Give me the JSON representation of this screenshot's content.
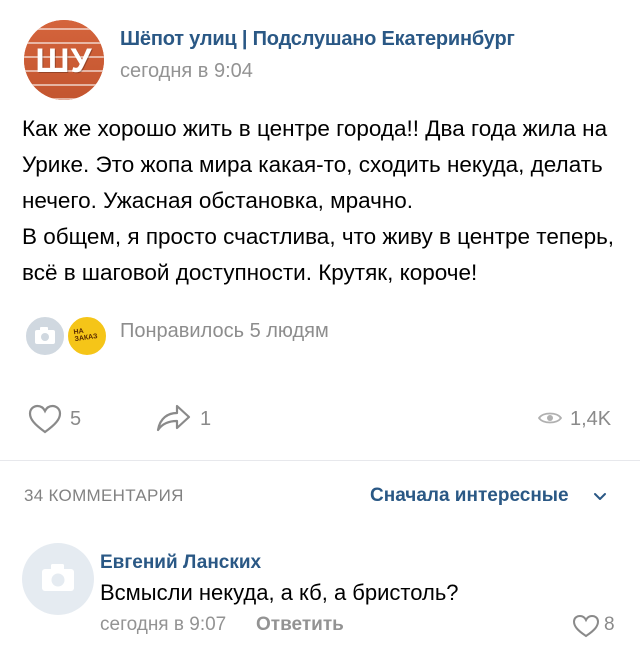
{
  "post": {
    "group_name": "Шёпот улиц | Подслушано Екатеринбург",
    "avatar_text": "ШУ",
    "time": "сегодня в 9:04",
    "text_lines": [
      "Как же хорошо жить в центре города!! Два года жила на Урике. Это жопа мира какая-то, сходить некуда, делать нечего. Ужасная обстановка, мрачно.",
      "В общем, я просто счастлива, что живу в центре теперь, всё в шаговой доступности. Крутяк, короче!"
    ],
    "liker_badge": "НА ЗАКАЗ",
    "liked_by": "Понравилось 5 людям",
    "likes": "5",
    "shares": "1",
    "views": "1,4K"
  },
  "comments_header": {
    "count_label": "34 КОММЕНТАРИЯ",
    "sort_label": "Сначала интересные"
  },
  "comment": {
    "author": "Евгений Ланских",
    "text": "Всмысли некуда, а кб, а бристоль?",
    "time": "сегодня в 9:07",
    "reply_label": "Ответить",
    "likes": "8"
  },
  "colors": {
    "link": "#2a5885",
    "muted": "#939393",
    "icon": "#8a8a8a"
  }
}
